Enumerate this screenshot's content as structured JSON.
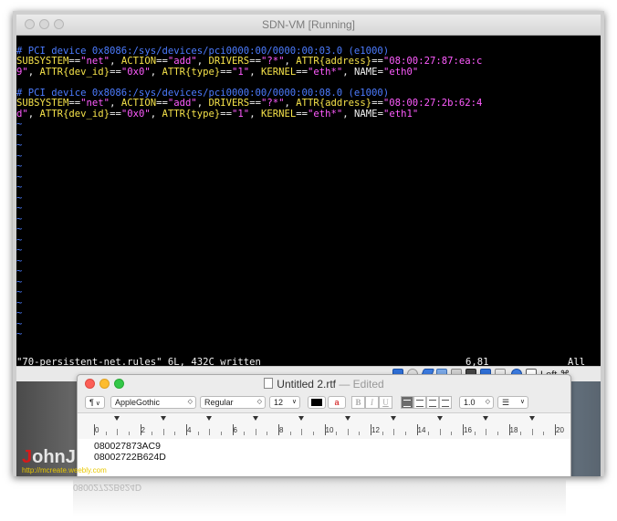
{
  "vm": {
    "title": "SDN-VM [Running]",
    "terminal": {
      "blocks": [
        {
          "comment": "# PCI device 0x8086:/sys/devices/pci0000:00/0000:00:03.0 (e1000)",
          "line1": [
            {
              "t": "SUBSYSTEM",
              "c": "yellow"
            },
            {
              "t": "==",
              "c": "white"
            },
            {
              "t": "\"net\"",
              "c": "magenta"
            },
            {
              "t": ", ",
              "c": "white"
            },
            {
              "t": "ACTION",
              "c": "yellow"
            },
            {
              "t": "==",
              "c": "white"
            },
            {
              "t": "\"add\"",
              "c": "magenta"
            },
            {
              "t": ", ",
              "c": "white"
            },
            {
              "t": "DRIVERS",
              "c": "yellow"
            },
            {
              "t": "==",
              "c": "white"
            },
            {
              "t": "\"?*\"",
              "c": "magenta"
            },
            {
              "t": ", ",
              "c": "white"
            },
            {
              "t": "ATTR{address}",
              "c": "yellow"
            },
            {
              "t": "==",
              "c": "white"
            },
            {
              "t": "\"08:00:27:87:ea:c",
              "c": "magenta"
            }
          ],
          "line2": [
            {
              "t": "9\"",
              "c": "magenta"
            },
            {
              "t": ", ",
              "c": "white"
            },
            {
              "t": "ATTR{dev_id}",
              "c": "yellow"
            },
            {
              "t": "==",
              "c": "white"
            },
            {
              "t": "\"0x0\"",
              "c": "magenta"
            },
            {
              "t": ", ",
              "c": "white"
            },
            {
              "t": "ATTR{type}",
              "c": "yellow"
            },
            {
              "t": "==",
              "c": "white"
            },
            {
              "t": "\"1\"",
              "c": "magenta"
            },
            {
              "t": ", ",
              "c": "white"
            },
            {
              "t": "KERNEL",
              "c": "yellow"
            },
            {
              "t": "==",
              "c": "white"
            },
            {
              "t": "\"eth*\"",
              "c": "magenta"
            },
            {
              "t": ", ",
              "c": "white"
            },
            {
              "t": "NAME",
              "c": "white"
            },
            {
              "t": "=",
              "c": "white"
            },
            {
              "t": "\"eth0\"",
              "c": "magenta"
            }
          ]
        },
        {
          "comment": "# PCI device 0x8086:/sys/devices/pci0000:00/0000:00:08.0 (e1000)",
          "line1": [
            {
              "t": "SUBSYSTEM",
              "c": "yellow"
            },
            {
              "t": "==",
              "c": "white"
            },
            {
              "t": "\"net\"",
              "c": "magenta"
            },
            {
              "t": ", ",
              "c": "white"
            },
            {
              "t": "ACTION",
              "c": "yellow"
            },
            {
              "t": "==",
              "c": "white"
            },
            {
              "t": "\"add\"",
              "c": "magenta"
            },
            {
              "t": ", ",
              "c": "white"
            },
            {
              "t": "DRIVERS",
              "c": "yellow"
            },
            {
              "t": "==",
              "c": "white"
            },
            {
              "t": "\"?*\"",
              "c": "magenta"
            },
            {
              "t": ", ",
              "c": "white"
            },
            {
              "t": "ATTR{address}",
              "c": "yellow"
            },
            {
              "t": "==",
              "c": "white"
            },
            {
              "t": "\"08:00:27:2b:62:4",
              "c": "magenta"
            }
          ],
          "line2": [
            {
              "t": "d\"",
              "c": "magenta"
            },
            {
              "t": ", ",
              "c": "white"
            },
            {
              "t": "ATTR{dev_id}",
              "c": "yellow"
            },
            {
              "t": "==",
              "c": "white"
            },
            {
              "t": "\"0x0\"",
              "c": "magenta"
            },
            {
              "t": ", ",
              "c": "white"
            },
            {
              "t": "ATTR{type}",
              "c": "yellow"
            },
            {
              "t": "==",
              "c": "white"
            },
            {
              "t": "\"1\"",
              "c": "magenta"
            },
            {
              "t": ", ",
              "c": "white"
            },
            {
              "t": "KERNEL",
              "c": "yellow"
            },
            {
              "t": "==",
              "c": "white"
            },
            {
              "t": "\"eth*\"",
              "c": "magenta"
            },
            {
              "t": ", ",
              "c": "white"
            },
            {
              "t": "NAME",
              "c": "white"
            },
            {
              "t": "=",
              "c": "white"
            },
            {
              "t": "\"eth1\"",
              "c": "magenta"
            }
          ]
        }
      ],
      "empty_line_marker": "~",
      "status_file": "\"70-persistent-net.rules\" 6L, 432C written",
      "status_pos": "6,81",
      "status_scroll": "All"
    },
    "statusbar": {
      "host_key_label": "Left ⌘"
    }
  },
  "textedit": {
    "file_title": "Untitled 2.rtf",
    "edited_label": "— Edited",
    "toolbar": {
      "paragraph_style": "¶",
      "font_name": "AppleGothic",
      "font_style": "Regular",
      "font_size": "12",
      "bold": "B",
      "italic": "I",
      "underline": "U",
      "line_spacing": "1.0",
      "list_style": "☰"
    },
    "ruler_numbers": [
      "0",
      "2",
      "4",
      "6",
      "8",
      "10",
      "12",
      "14",
      "16",
      "18",
      "20"
    ],
    "doc_lines": [
      "080027873AC9",
      "08002722B624D"
    ]
  },
  "watermark": {
    "name": "JohnJ",
    "url": "http://mcreate.weebly.com"
  },
  "colors": {
    "terminal_bg": "#000000",
    "comment": "#4c7cff",
    "keyword": "#f5e24a",
    "string": "#ff5cff",
    "plain": "#f2f2f2",
    "watermark_accent": "#d61a1a"
  }
}
